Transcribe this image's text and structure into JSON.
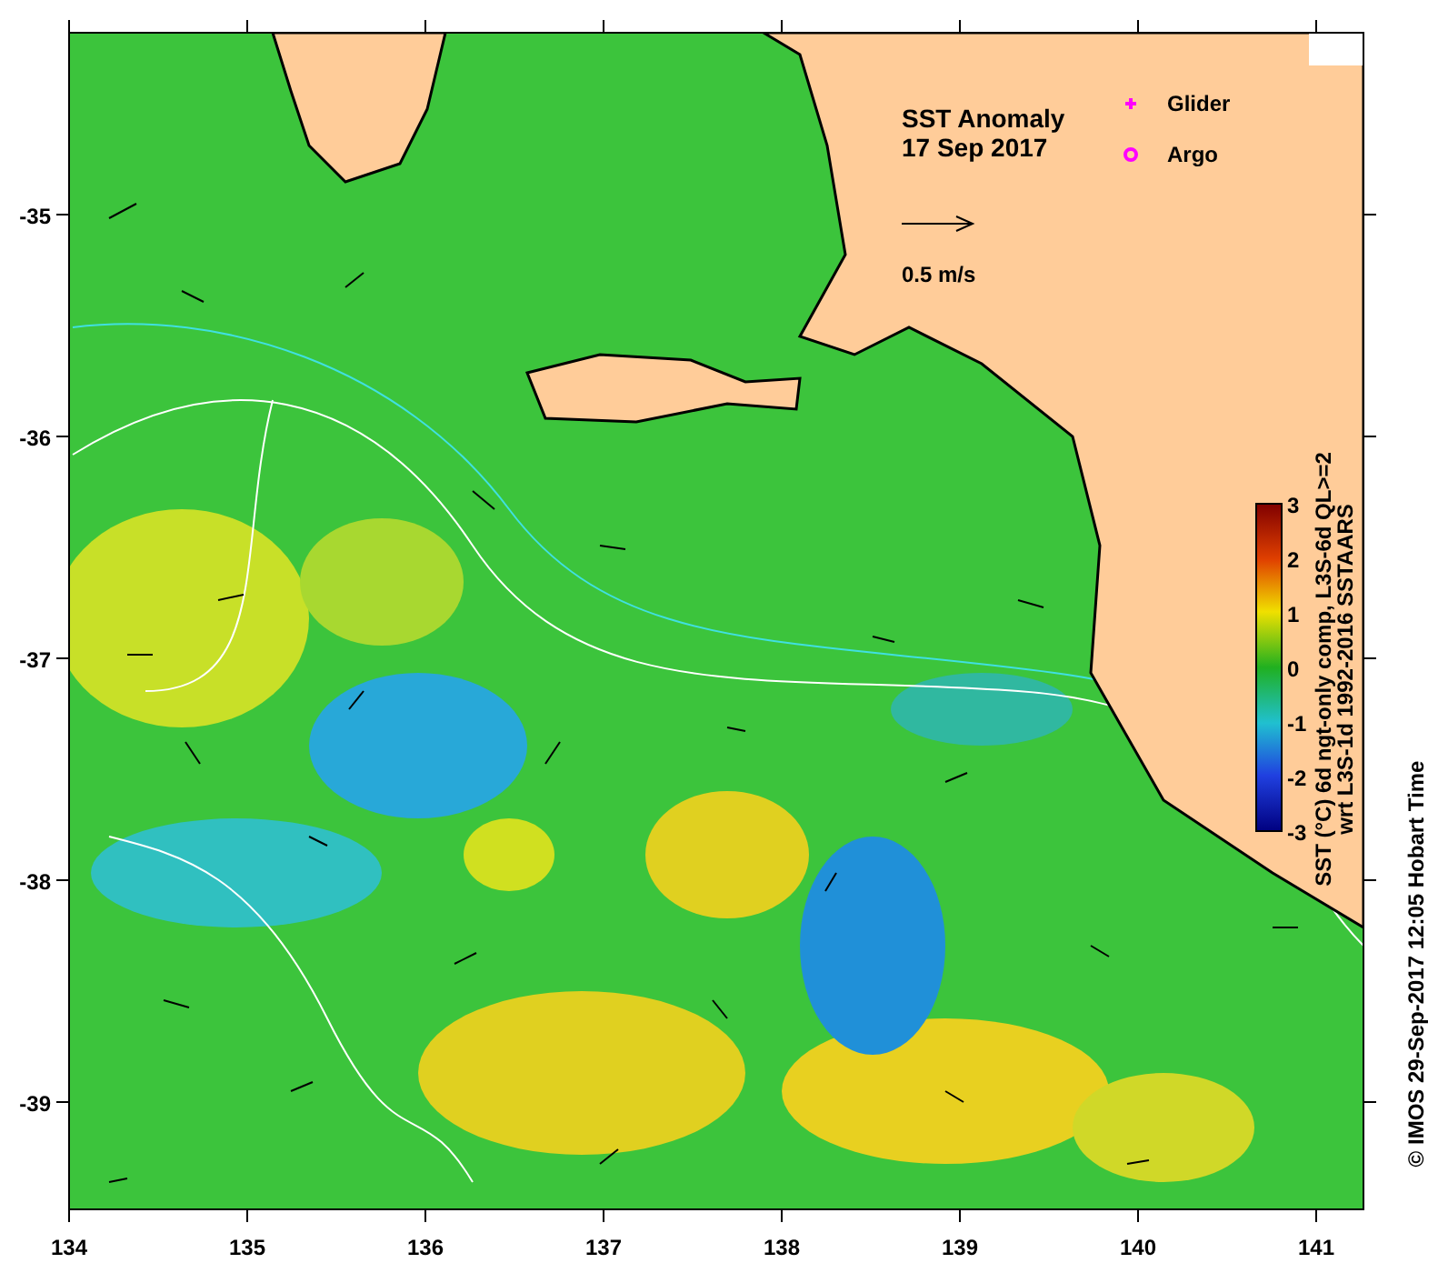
{
  "map": {
    "title": "SST Anomaly",
    "date": "17 Sep 2017",
    "current_scale": "0.5 m/s",
    "legend": [
      {
        "label": "Glider",
        "kind": "plus"
      },
      {
        "label": "Argo",
        "kind": "ring"
      }
    ]
  },
  "x_axis": {
    "ticks": [
      "134",
      "135",
      "136",
      "137",
      "138",
      "139",
      "140",
      "141"
    ]
  },
  "y_axis": {
    "ticks": [
      "-35",
      "-36",
      "-37",
      "-38",
      "-39"
    ]
  },
  "colorbar": {
    "ticks": [
      "3",
      "2",
      "1",
      "0",
      "-1",
      "-2",
      "-3"
    ],
    "label_lines": [
      "SST (°C) 6d ngt-only comp, L3S-6d QL>=2",
      "wrt L3S-1d 1992-2016 SSTAARS"
    ]
  },
  "credit": "© IMOS 29-Sep-2017 12:05 Hobart Time"
}
